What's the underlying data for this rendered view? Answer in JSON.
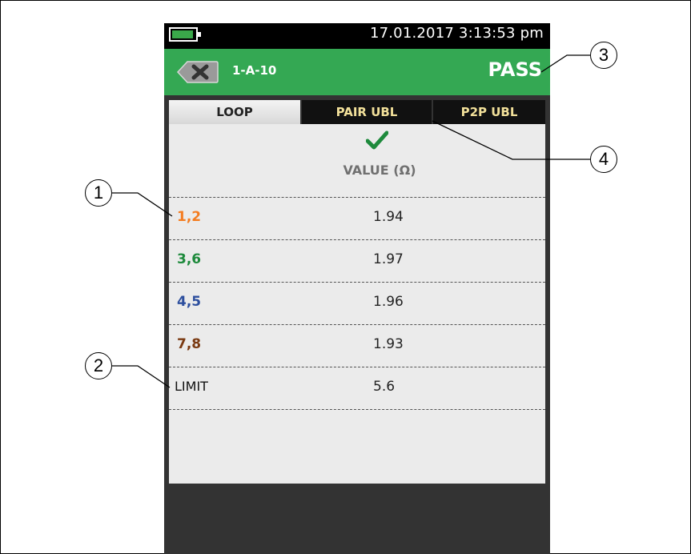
{
  "status_bar": {
    "datetime": "17.01.2017 3:13:53 pm"
  },
  "header": {
    "id": "1-A-10",
    "result": "PASS"
  },
  "tabs": [
    {
      "label": "LOOP"
    },
    {
      "label": "PAIR UBL"
    },
    {
      "label": "P2P UBL"
    }
  ],
  "table": {
    "column_header": "VALUE (Ω)",
    "rows": [
      {
        "pair": "1,2",
        "value": "1.94",
        "color": "#f47c20"
      },
      {
        "pair": "3,6",
        "value": "1.97",
        "color": "#1e8a3c"
      },
      {
        "pair": "4,5",
        "value": "1.96",
        "color": "#2d4f9e"
      },
      {
        "pair": "7,8",
        "value": "1.93",
        "color": "#7a3a12"
      }
    ],
    "limit": {
      "label": "LIMIT",
      "value": "5.6"
    }
  },
  "callouts": [
    "1",
    "2",
    "3",
    "4"
  ],
  "colors": {
    "pass_green": "#34a853",
    "tab_text": "#f2e09a"
  }
}
